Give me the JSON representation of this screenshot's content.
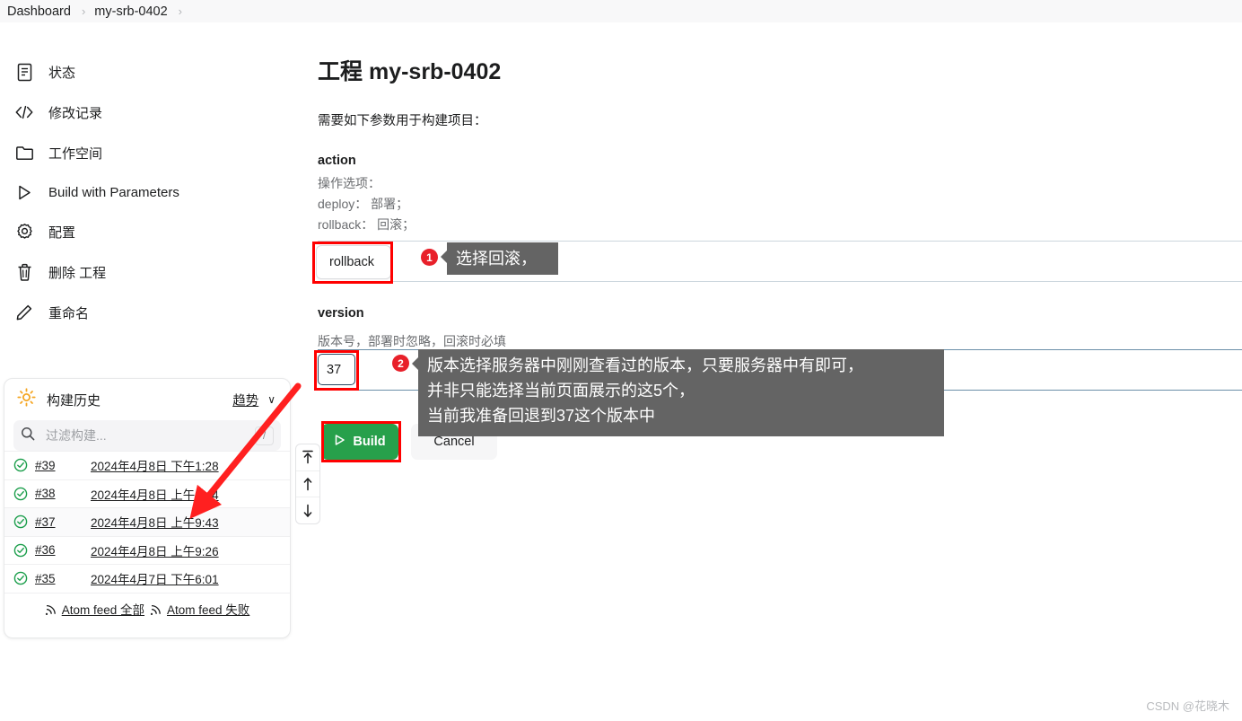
{
  "breadcrumb": {
    "items": [
      "Dashboard",
      "my-srb-0402"
    ],
    "separator": "›"
  },
  "sidebar": {
    "items": [
      {
        "label": "状态",
        "icon": "document-icon"
      },
      {
        "label": "修改记录",
        "icon": "code-icon"
      },
      {
        "label": "工作空间",
        "icon": "folder-icon"
      },
      {
        "label": "Build with Parameters",
        "icon": "play-icon"
      },
      {
        "label": "配置",
        "icon": "gear-icon"
      },
      {
        "label": "删除 工程",
        "icon": "trash-icon"
      },
      {
        "label": "重命名",
        "icon": "pencil-icon"
      }
    ]
  },
  "build_history": {
    "title": "构建历史",
    "trend_label": "趋势",
    "caret": "∨",
    "search_placeholder": "过滤构建...",
    "search_value": "",
    "slash_hint": "/",
    "rows": [
      {
        "number": "#39",
        "date": "2024年4月8日 下午1:28",
        "status": "success",
        "selected": false
      },
      {
        "number": "#38",
        "date": "2024年4月8日 上午9:44",
        "status": "success",
        "selected": false
      },
      {
        "number": "#37",
        "date": "2024年4月8日 上午9:43",
        "status": "success",
        "selected": true
      },
      {
        "number": "#36",
        "date": "2024年4月8日 上午9:26",
        "status": "success",
        "selected": false
      },
      {
        "number": "#35",
        "date": "2024年4月7日 下午6:01",
        "status": "success",
        "selected": false
      }
    ],
    "feeds": [
      {
        "label": "Atom feed 全部"
      },
      {
        "label": "Atom feed 失败"
      }
    ]
  },
  "main": {
    "title_prefix": "工程",
    "title_project": "my-srb-0402",
    "intro": "需要如下参数用于构建项目：",
    "params": [
      {
        "name": "action",
        "description": "操作选项：\ndeploy： 部署；\nrollback： 回滚；",
        "value": "rollback",
        "type": "select"
      },
      {
        "name": "version",
        "description": "版本号，部署时忽略，回滚时必填",
        "value": "37",
        "type": "text"
      }
    ],
    "build_label": "Build",
    "cancel_label": "Cancel"
  },
  "annotations": [
    {
      "badge": "1",
      "text": "选择回滚，"
    },
    {
      "badge": "2",
      "text": "版本选择服务器中刚刚查看过的版本，只要服务器中有即可，\n并非只能选择当前页面展示的这5个，\n当前我准备回退到37这个版本中"
    }
  ],
  "scroll_rail": {
    "buttons": [
      "jump-top-icon",
      "arrow-up-icon",
      "arrow-down-icon"
    ]
  },
  "watermark": "CSDN @花晓木",
  "colors": {
    "accent_green": "#27a04b",
    "annotation_red": "#ff0000",
    "badge_red": "#e8202a",
    "callout_gray": "#646464",
    "focus_blue": "#2b4a63",
    "success_green": "#1b9e4b"
  }
}
